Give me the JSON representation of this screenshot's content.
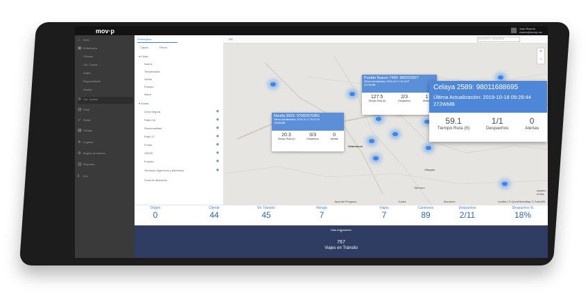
{
  "app": {
    "logo": "mov·p",
    "user_name": "Juan Ricardo",
    "user_email": "ricardo@movip.mx"
  },
  "nav": {
    "items": [
      {
        "label": "Inicio",
        "icon": "home-icon"
      },
      {
        "label": "Embarques",
        "icon": "package-icon"
      },
      {
        "label": "Clientes",
        "icon": ""
      },
      {
        "label": "Cto. Costos",
        "icon": ""
      },
      {
        "label": "Viajes",
        "icon": ""
      },
      {
        "label": "Disponibilidad",
        "icon": ""
      },
      {
        "label": "Gastos",
        "icon": ""
      },
      {
        "label": "Cto. Costos",
        "icon": "gear-icon"
      },
      {
        "label": "Flota",
        "icon": "truck-icon"
      },
      {
        "label": "Rutas",
        "icon": "route-icon"
      },
      {
        "label": "Cargas",
        "icon": "box-icon"
      },
      {
        "label": "Lugares",
        "icon": "location-icon"
      },
      {
        "label": "Reglas de Alarma",
        "icon": "alarm-icon"
      },
      {
        "label": "Reportes",
        "icon": "report-icon"
      },
      {
        "label": "Info",
        "icon": "info-icon"
      }
    ]
  },
  "panel": {
    "search_value": "Embarques",
    "tabs": [
      "Capas",
      "Filtros"
    ],
    "section_clima": "Clima",
    "clima_items": [
      "Nubes",
      "Temperatura",
      "Viento",
      "Presión",
      "Nieve"
    ],
    "section_zonas": "Zonas",
    "zonas_items": [
      "Zona Segura",
      "Patio Col.",
      "Descomalidad",
      "Patio 17",
      "Fondo",
      "CEDIS",
      "Frosted",
      "Servicios Higiénicos y Alimentos",
      "Zona de descanso"
    ]
  },
  "map": {
    "dropdown": "GC",
    "date_range": "10/10/2019 - 10/11/2019",
    "attribution": "Leaflet | © OpenStreetMap © CartoDB",
    "zoom_in": "+",
    "zoom_out": "−",
    "cities": [
      "Pueblo Nuevo",
      "Celaya",
      "Salamanca",
      "Irapuato",
      "Villagrán",
      "Cortazar",
      "Tarimoro",
      "Apaseo el Alto",
      "Jaral del Progreso",
      "Yuriria",
      "Moroleón"
    ],
    "popup1": {
      "title": "Pueblo Nuevo 7494: 980202827",
      "subtitle": "Última Actualización: 2019-10-17 19:16 IP",
      "code": "207WMB",
      "v1": "127.5",
      "l1": "Tiempo Ruta (h)",
      "v2": "2/3",
      "l2": "Despachos",
      "v3": "1",
      "l3": "Alertas"
    },
    "popup2": {
      "title": "Neutla 3925: 97992976461",
      "subtitle": "Última Actualización: 2019-10-17 20:41:15",
      "code": "159WMB",
      "v1": "20.3",
      "l1": "Tiempo Ruta (h)",
      "v2": "0/3",
      "l2": "Despachos",
      "v3": "0",
      "l3": "Alertas"
    }
  },
  "featured": {
    "title": "Celaya 2589: 98011688695",
    "updated": "Última Actualización: 2019-10-18 09:28:44",
    "code": "272WMB",
    "v1": "59.1",
    "l1": "Tiempo Ruta (h)",
    "v2": "1/1",
    "l2": "Despachos",
    "v3": "0",
    "l3": "Alertas"
  },
  "summary": [
    {
      "label": "Origen",
      "value": "0"
    },
    {
      "label": "Cliente",
      "value": "44"
    },
    {
      "label": "En Tránsito",
      "value": "45"
    },
    {
      "label": "Riesgo",
      "value": "7"
    },
    {
      "label": "Viajes",
      "value": "7"
    },
    {
      "label": "Camiones",
      "value": "89"
    },
    {
      "label": "Despachos",
      "value": "2/11"
    },
    {
      "label": "Despachos %",
      "value": "18%"
    }
  ],
  "bottom": {
    "more": "Más Indicadores",
    "caret": "^",
    "count": "767",
    "caption": "Viajes en Tránsito"
  },
  "colors": {
    "accent": "#3f7fd0",
    "bottom_bg": "#2f3d63",
    "marker_red": "#e82a2a",
    "marker_blue": "#3d86e8"
  }
}
